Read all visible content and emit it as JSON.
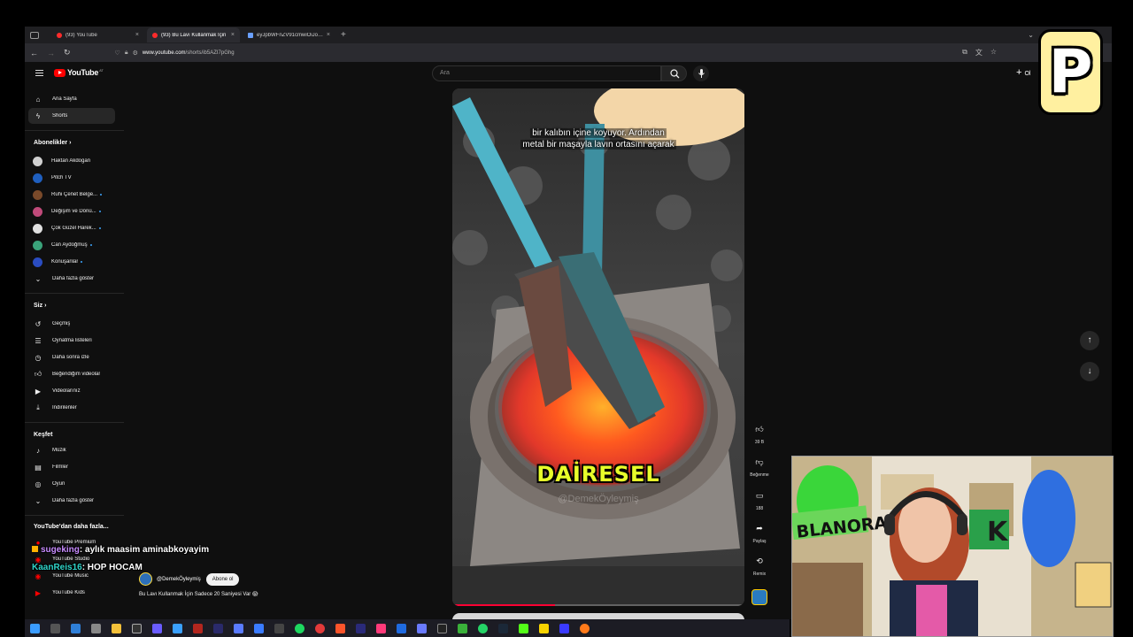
{
  "browser": {
    "tabs": [
      {
        "label": "(93) YouTube",
        "active": false
      },
      {
        "label": "(93) Bu Lavı Kullanmak İçin",
        "active": true
      },
      {
        "label": "eyJpbWFnZV91cmwiOiJodHRw",
        "active": false
      }
    ],
    "url_host": "www.youtube.com",
    "url_path": "/shorts/ib5AZI7pGhg"
  },
  "youtube": {
    "logo_text": "YouTube",
    "logo_country": "AT",
    "search_placeholder": "Ara",
    "create_label": "Ol",
    "sidebar": {
      "main": [
        {
          "label": "Ana Sayfa",
          "icon": "home-icon",
          "active": false
        },
        {
          "label": "Shorts",
          "icon": "shorts-icon",
          "active": true
        }
      ],
      "subs_header": "Abonelikler",
      "subscriptions": [
        {
          "label": "Haktan Akdogan",
          "color": "#d0d0d0",
          "new": false
        },
        {
          "label": "Pitch TV",
          "color": "#1f5fbf",
          "new": false
        },
        {
          "label": "Ruhi Çenet Belge...",
          "color": "#7a4a2a",
          "new": true
        },
        {
          "label": "Değişim ve Dönü...",
          "color": "#c04a7a",
          "new": true
        },
        {
          "label": "Çok Güzel Harek...",
          "color": "#e0e0e0",
          "new": true
        },
        {
          "label": "Can Aydoğmuş",
          "color": "#3aa37a",
          "new": true
        },
        {
          "label": "Konuşanlar",
          "color": "#2a4cc0",
          "new": true
        }
      ],
      "show_more": "Daha fazla göster",
      "you_header": "Siz",
      "you": [
        {
          "label": "Geçmiş",
          "icon": "history-icon"
        },
        {
          "label": "Oynatma listeleri",
          "icon": "playlists-icon"
        },
        {
          "label": "Daha sonra izle",
          "icon": "watch-later-icon"
        },
        {
          "label": "Beğendiğim videolar",
          "icon": "liked-videos-icon"
        },
        {
          "label": "Videolarınız",
          "icon": "your-videos-icon"
        },
        {
          "label": "İndirilenler",
          "icon": "downloads-icon"
        }
      ],
      "explore_header": "Keşfet",
      "explore": [
        {
          "label": "Müzik",
          "icon": "music-icon"
        },
        {
          "label": "Filmler",
          "icon": "films-icon"
        },
        {
          "label": "Oyun",
          "icon": "gaming-icon"
        }
      ],
      "show_more_2": "Daha fazla göster",
      "more_header": "YouTube'dan daha fazla...",
      "more": [
        {
          "label": "YouTube Premium"
        },
        {
          "label": "YouTube Studio"
        },
        {
          "label": "YouTube Music"
        },
        {
          "label": "YouTube Kids"
        }
      ]
    },
    "short": {
      "subtitle_line1": "bir kalıbın içine koyuyor. Ardından",
      "subtitle_line2": "metal bir maşayla lavın ortasını açarak",
      "caption_big": "DAİRESEL",
      "watermark": "@DemekÖyleymiş",
      "progress": 0.35,
      "channel": "@DemekÖyleymiş",
      "subscribe_label": "Abone ol",
      "description": "Bu Lavı Kullanmak İçin Sadece 20 Saniyesi Var 😱"
    },
    "actions": {
      "likes": "39 B",
      "dislike_label": "Beğenme",
      "comments": "188",
      "share_label": "Paylaş",
      "remix_label": "Remix"
    }
  },
  "stream": {
    "chat": [
      {
        "user": "sugeking",
        "message": ": aylık maasim aminabkoyayim"
      },
      {
        "user": "KaanReis16",
        "message": ": HOP HOCAM"
      }
    ],
    "webcam_sign": "BLANORA"
  }
}
